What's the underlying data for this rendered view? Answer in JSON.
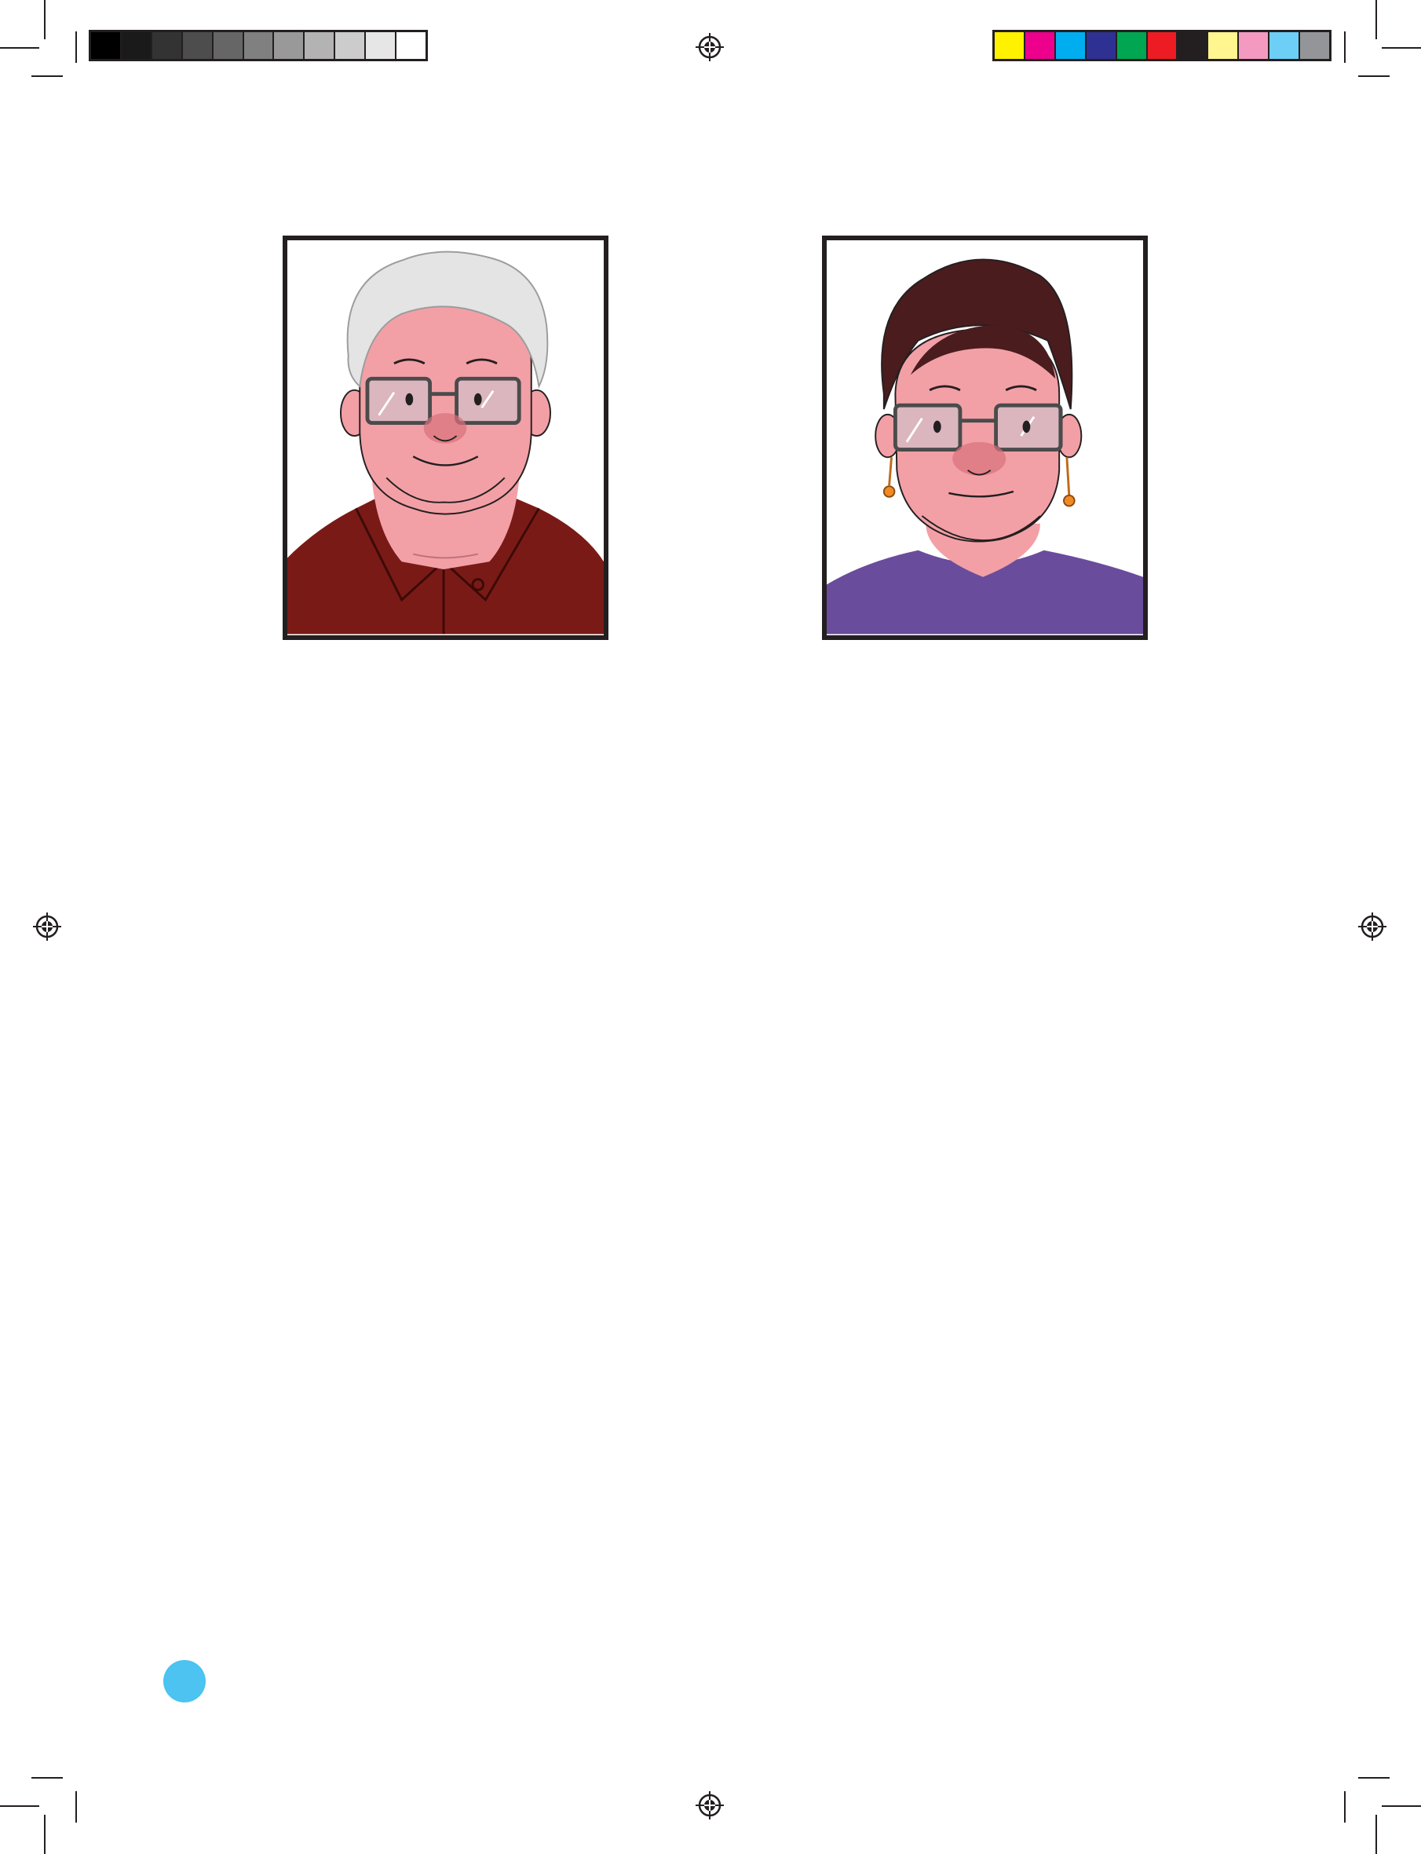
{
  "colors": {
    "page_marker": "#4cc3f0",
    "grayscale_bar": [
      "#000000",
      "#1a1a1a",
      "#333333",
      "#4d4d4d",
      "#666666",
      "#808080",
      "#999999",
      "#b3b3b3",
      "#cccccc",
      "#e6e6e6",
      "#ffffff"
    ],
    "color_bar": [
      "#fff200",
      "#ec008c",
      "#00aeef",
      "#2e3192",
      "#00a651",
      "#ed1c24",
      "#231f20",
      "#fff68f",
      "#f49ac1",
      "#6dcff6",
      "#939598"
    ],
    "man_shirt": "#7a1a16",
    "woman_shirt": "#6a4c9c",
    "skin": "#f2a0a6",
    "man_hair": "#e4e4e4",
    "woman_hair": "#4a1c1e"
  },
  "portraits": [
    {
      "id": "man",
      "icon": "portrait-older-man-icon"
    },
    {
      "id": "woman",
      "icon": "portrait-woman-icon"
    }
  ]
}
